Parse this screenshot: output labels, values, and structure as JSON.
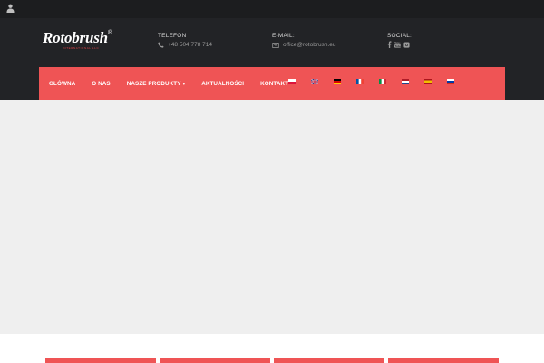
{
  "topbar": {
    "user_icon": "user-icon"
  },
  "brand": {
    "name": "Rotobrush",
    "registered": "®",
    "tagline": "International LLC"
  },
  "contact": {
    "phone_label": "TELEFON",
    "phone_value": "+48 504 778 714",
    "email_label": "E-MAIL:",
    "email_value": "office@rotobrush.eu",
    "social_label": "SOCIAL:",
    "social_icons": [
      "facebook-icon",
      "youtube-icon",
      "instagram-icon"
    ]
  },
  "nav": {
    "items": [
      {
        "label": "GŁÓWNA"
      },
      {
        "label": "O NAS"
      },
      {
        "label": "NASZE PRODUKTY",
        "caret": "▾"
      },
      {
        "label": "AKTUALNOŚCI"
      },
      {
        "label": "KONTAKT"
      }
    ],
    "flags": [
      "pl",
      "gb",
      "de",
      "fr",
      "it",
      "nl",
      "es",
      "ru"
    ]
  },
  "colors": {
    "accent": "#ef5455",
    "header_bg": "#222326",
    "topbar_bg": "#1c1d1f",
    "slider_bg": "#efefef"
  }
}
